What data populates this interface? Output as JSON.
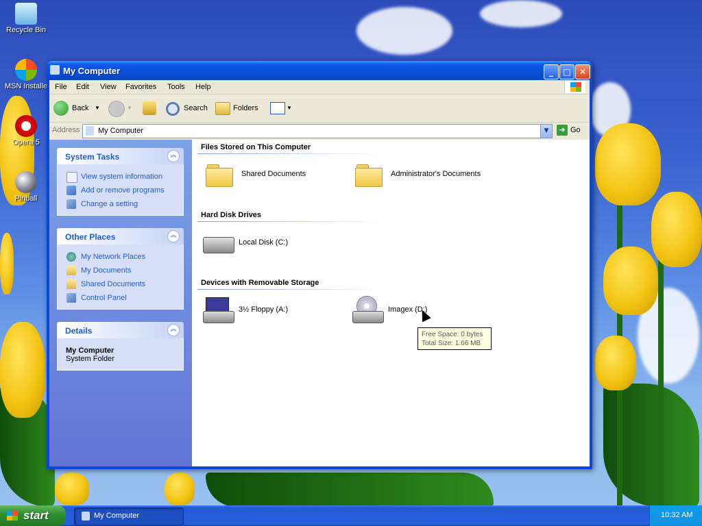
{
  "desktop": {
    "icons": [
      {
        "label": "Recycle Bin"
      },
      {
        "label": "MSN Installe"
      },
      {
        "label": "Opera 5"
      },
      {
        "label": "Pinball"
      }
    ]
  },
  "window": {
    "title": "My Computer",
    "menu": [
      "File",
      "Edit",
      "View",
      "Favorites",
      "Tools",
      "Help"
    ],
    "toolbar": {
      "back": "Back",
      "search": "Search",
      "folders": "Folders"
    },
    "address": {
      "label": "Address",
      "value": "My Computer",
      "go": "Go"
    }
  },
  "sidebar": {
    "system_tasks": {
      "title": "System Tasks",
      "items": [
        "View system information",
        "Add or remove programs",
        "Change a setting"
      ]
    },
    "other_places": {
      "title": "Other Places",
      "items": [
        "My Network Places",
        "My Documents",
        "Shared Documents",
        "Control Panel"
      ]
    },
    "details": {
      "title": "Details",
      "name": "My Computer",
      "type": "System Folder"
    }
  },
  "content": {
    "sections": [
      {
        "title": "Files Stored on This Computer",
        "items": [
          "Shared Documents",
          "Administrator's Documents"
        ]
      },
      {
        "title": "Hard Disk Drives",
        "items": [
          "Local Disk (C:)"
        ]
      },
      {
        "title": "Devices with Removable Storage",
        "items": [
          "3½ Floppy (A:)",
          "Imagex (D:)"
        ]
      }
    ],
    "tooltip": {
      "free_space": "Free Space: 0 bytes",
      "total_size": "Total Size: 1.66 MB"
    }
  },
  "taskbar": {
    "start": "start",
    "task": "My Computer",
    "clock": "10:32 AM"
  }
}
